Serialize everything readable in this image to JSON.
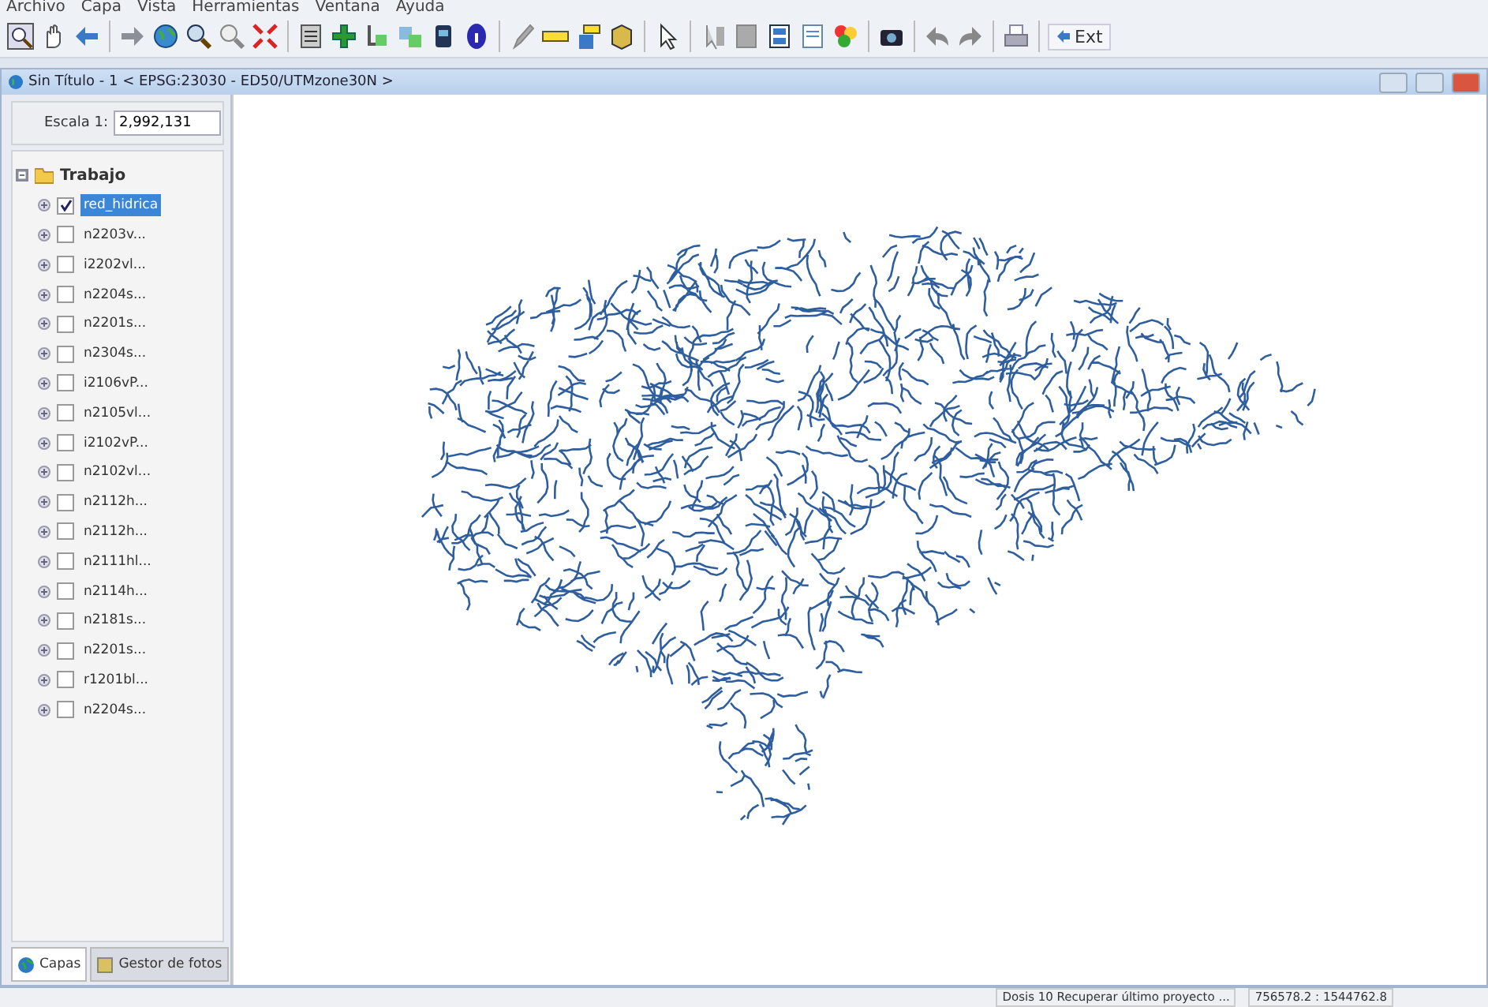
{
  "menu_bar": [
    "Archivo",
    "Capa",
    "Vista",
    "Herramientas",
    "Ventana",
    "Ayuda"
  ],
  "toolbar": {
    "ext_button": "Ext"
  },
  "view_window": {
    "title": "Sin Título - 1 < EPSG:23030 - ED50/UTMzone30N >"
  },
  "scale": {
    "label": "Escala 1:",
    "value": "2,992,131"
  },
  "layer_tree": {
    "label": "Trabajo",
    "expanded": true,
    "children": [
      {
        "label": "red_hidrica",
        "checked": true,
        "selected": true
      },
      {
        "label": "n2203v...",
        "checked": false,
        "selected": false
      },
      {
        "label": "i2202vl...",
        "checked": false,
        "selected": false
      },
      {
        "label": "n2204s...",
        "checked": false,
        "selected": false
      },
      {
        "label": "n2201s...",
        "checked": false,
        "selected": false
      },
      {
        "label": "n2304s...",
        "checked": false,
        "selected": false
      },
      {
        "label": "i2106vP...",
        "checked": false,
        "selected": false
      },
      {
        "label": "n2105vl...",
        "checked": false,
        "selected": false
      },
      {
        "label": "i2102vP...",
        "checked": false,
        "selected": false
      },
      {
        "label": "n2102vl...",
        "checked": false,
        "selected": false
      },
      {
        "label": "n2112h...",
        "checked": false,
        "selected": false
      },
      {
        "label": "n2112h...",
        "checked": false,
        "selected": false
      },
      {
        "label": "n2111hl...",
        "checked": false,
        "selected": false
      },
      {
        "label": "n2114h...",
        "checked": false,
        "selected": false
      },
      {
        "label": "n2181s...",
        "checked": false,
        "selected": false
      },
      {
        "label": "n2201s...",
        "checked": false,
        "selected": false
      },
      {
        "label": "r1201bl...",
        "checked": false,
        "selected": false
      },
      {
        "label": "n2204s...",
        "checked": false,
        "selected": false
      }
    ]
  },
  "panel_tabs": [
    {
      "label": "Capas",
      "selected": true
    },
    {
      "label": "Gestor de fotos",
      "selected": false
    }
  ],
  "status_bar": {
    "message": "Dosis 10 Recuperar último proyecto ...",
    "coordinates": "756578.2 : 1544762.8"
  }
}
